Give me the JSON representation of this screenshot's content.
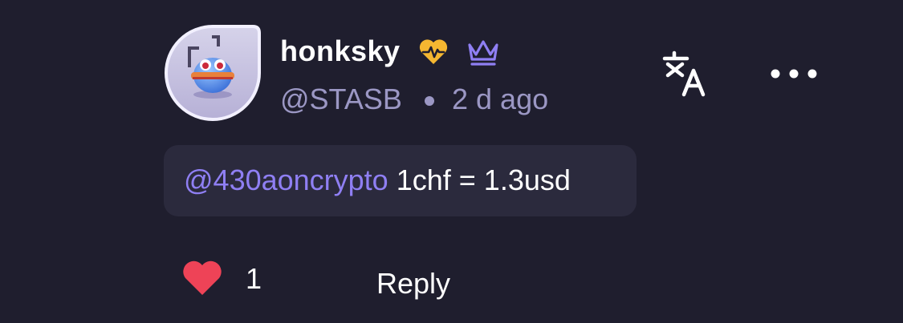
{
  "comment": {
    "avatar_alt": "avatar",
    "username": "honksky",
    "badges": [
      "heart-pulse-icon",
      "crown-icon"
    ],
    "handle": "@STASB",
    "separator": "•",
    "time": "2 d ago",
    "message": {
      "mention": "@430aoncrypto",
      "text": " 1chf = 1.3usd"
    },
    "like_count": "1",
    "reply_label": "Reply"
  },
  "colors": {
    "background": "#1f1e2e",
    "bubble": "#2b2a3d",
    "muted": "#9b97c4",
    "mention": "#8f7ff3",
    "heart": "#ee4357",
    "badge_heart": "#f5b731",
    "badge_crown": "#8f7ff3"
  }
}
